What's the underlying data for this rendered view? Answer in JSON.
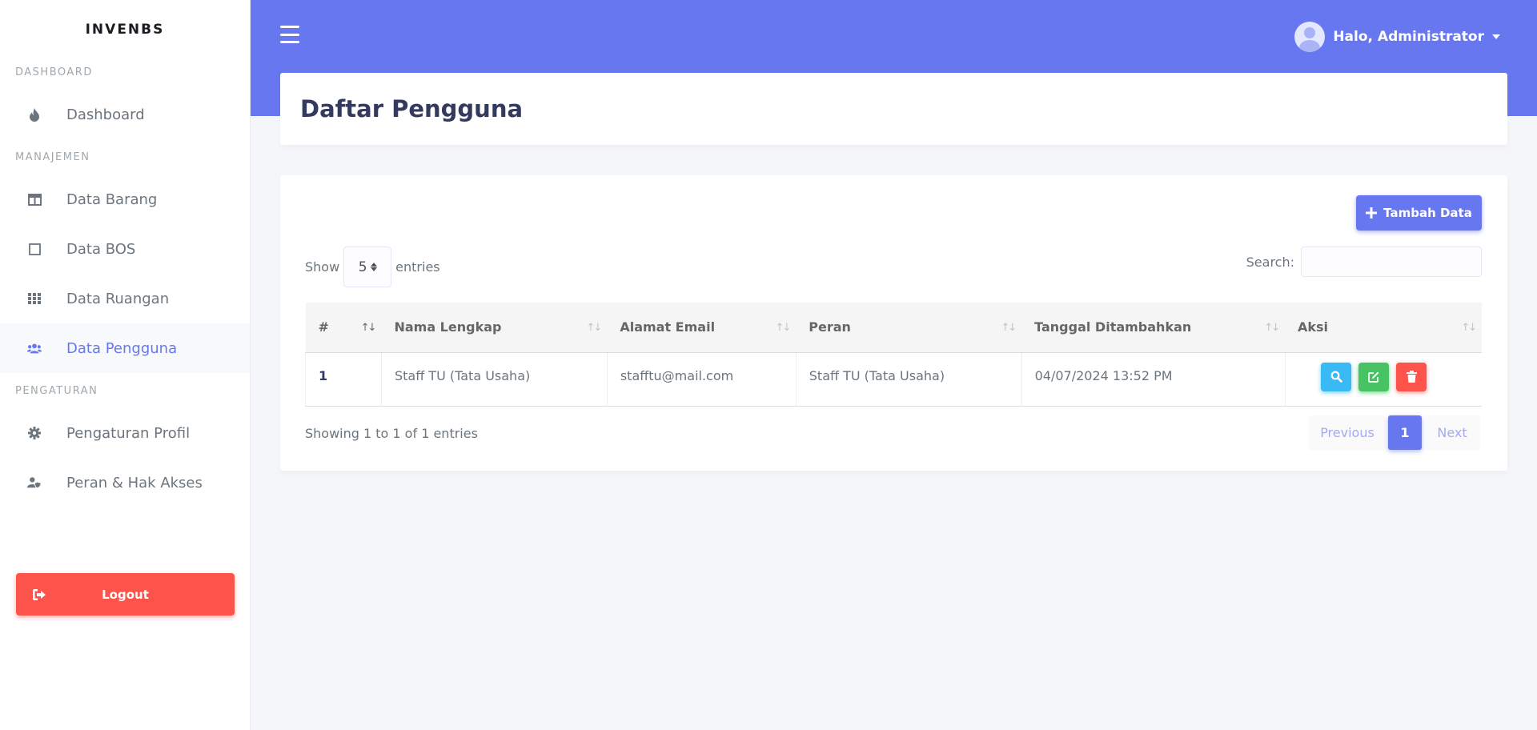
{
  "app": {
    "brand": "INVENBS"
  },
  "sidebar": {
    "sections": [
      {
        "header": "DASHBOARD",
        "items": [
          {
            "label": "Dashboard",
            "icon": "fire-icon"
          }
        ]
      },
      {
        "header": "MANAJEMEN",
        "items": [
          {
            "label": "Data Barang",
            "icon": "columns-icon"
          },
          {
            "label": "Data BOS",
            "icon": "square-icon"
          },
          {
            "label": "Data Ruangan",
            "icon": "grid-icon"
          },
          {
            "label": "Data Pengguna",
            "icon": "users-icon",
            "active": true
          }
        ]
      },
      {
        "header": "PENGATURAN",
        "items": [
          {
            "label": "Pengaturan Profil",
            "icon": "gear-icon"
          },
          {
            "label": "Peran & Hak Akses",
            "icon": "user-shield-icon"
          }
        ]
      }
    ],
    "logout_label": "Logout"
  },
  "navbar": {
    "user_greeting": "Halo, Administrator"
  },
  "page": {
    "title": "Daftar Pengguna"
  },
  "toolbar": {
    "add_label": "Tambah Data",
    "show_label": "Show",
    "entries_label": "entries",
    "page_length": "5",
    "search_label": "Search:",
    "search_value": ""
  },
  "table": {
    "columns": [
      "#",
      "Nama Lengkap",
      "Alamat Email",
      "Peran",
      "Tanggal Ditambahkan",
      "Aksi"
    ],
    "rows": [
      {
        "no": "1",
        "nama": "Staff TU (Tata Usaha)",
        "email": "stafftu@mail.com",
        "peran": "Staff TU (Tata Usaha)",
        "tanggal": "04/07/2024 13:52 PM"
      }
    ]
  },
  "footer": {
    "info": "Showing 1 to 1 of 1 entries",
    "prev_label": "Previous",
    "current_page": "1",
    "next_label": "Next"
  },
  "colors": {
    "primary": "#6777ef",
    "danger": "#fc544b",
    "info": "#3abaf4",
    "success": "#47c363"
  }
}
